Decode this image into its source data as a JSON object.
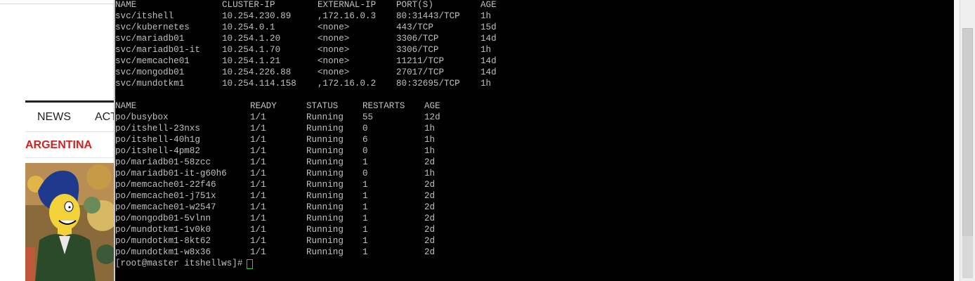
{
  "left_page": {
    "nav_items": [
      "NEWS",
      "ACTUALIDAD"
    ],
    "section_title": "ARGENTINA"
  },
  "terminal": {
    "services": {
      "headers": [
        "NAME",
        "CLUSTER-IP",
        "EXTERNAL-IP",
        "PORT(S)",
        "AGE"
      ],
      "rows": [
        [
          "svc/itshell",
          "10.254.230.89",
          ",172.16.0.3",
          "80:31443/TCP",
          "1h"
        ],
        [
          "svc/kubernetes",
          "10.254.0.1",
          "<none>",
          "443/TCP",
          "15d"
        ],
        [
          "svc/mariadb01",
          "10.254.1.20",
          "<none>",
          "3306/TCP",
          "14d"
        ],
        [
          "svc/mariadb01-it",
          "10.254.1.70",
          "<none>",
          "3306/TCP",
          "1h"
        ],
        [
          "svc/memcache01",
          "10.254.1.21",
          "<none>",
          "11211/TCP",
          "14d"
        ],
        [
          "svc/mongodb01",
          "10.254.226.88",
          "<none>",
          "27017/TCP",
          "14d"
        ],
        [
          "svc/mundotkm1",
          "10.254.114.158",
          ",172.16.0.2",
          "80:32695/TCP",
          "1h"
        ]
      ]
    },
    "pods": {
      "headers": [
        "NAME",
        "READY",
        "STATUS",
        "RESTARTS",
        "AGE"
      ],
      "rows": [
        [
          "po/busybox",
          "1/1",
          "Running",
          "55",
          "12d"
        ],
        [
          "po/itshell-23nxs",
          "1/1",
          "Running",
          "0",
          "1h"
        ],
        [
          "po/itshell-40h1g",
          "1/1",
          "Running",
          "6",
          "1h"
        ],
        [
          "po/itshell-4pm82",
          "1/1",
          "Running",
          "0",
          "1h"
        ],
        [
          "po/mariadb01-58zcc",
          "1/1",
          "Running",
          "1",
          "2d"
        ],
        [
          "po/mariadb01-it-g60h6",
          "1/1",
          "Running",
          "0",
          "1h"
        ],
        [
          "po/memcache01-22f46",
          "1/1",
          "Running",
          "1",
          "2d"
        ],
        [
          "po/memcache01-j751x",
          "1/1",
          "Running",
          "1",
          "2d"
        ],
        [
          "po/memcache01-w2547",
          "1/1",
          "Running",
          "1",
          "2d"
        ],
        [
          "po/mongodb01-5vlnn",
          "1/1",
          "Running",
          "1",
          "2d"
        ],
        [
          "po/mundotkm1-1v0k0",
          "1/1",
          "Running",
          "1",
          "2d"
        ],
        [
          "po/mundotkm1-8kt62",
          "1/1",
          "Running",
          "1",
          "2d"
        ],
        [
          "po/mundotkm1-w8x36",
          "1/1",
          "Running",
          "1",
          "2d"
        ]
      ]
    },
    "prompt": "[root@master itshellws]#"
  },
  "colors": {
    "terminal_bg": "#000000",
    "terminal_fg": "#c0c0c0",
    "cursor": "#22d13a",
    "section_red": "#d0231f"
  }
}
